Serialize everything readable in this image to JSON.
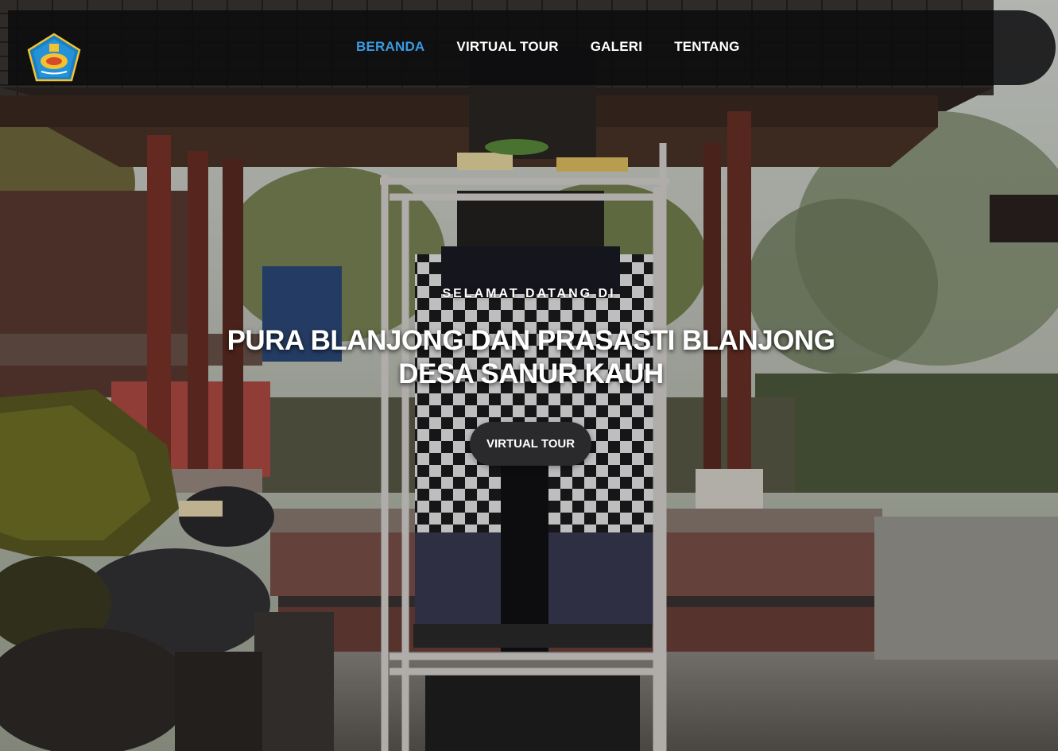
{
  "colors": {
    "accent": "#3a9ae0",
    "navbar_bg": "#0c0c0e",
    "cta_bg": "#2a2a2d",
    "text": "#ffffff"
  },
  "navbar": {
    "logo_icon": "regional-emblem-icon",
    "items": [
      {
        "label": "BERANDA",
        "active": true
      },
      {
        "label": "VIRTUAL TOUR",
        "active": false
      },
      {
        "label": "GALERI",
        "active": false
      },
      {
        "label": "TENTANG",
        "active": false
      }
    ]
  },
  "hero": {
    "welcome": "SELAMAT DATANG DI",
    "title_line1": "PURA BLANJONG DAN PRASASTI BLANJONG",
    "title_line2": "DESA SANUR KAUH",
    "cta_label": "VIRTUAL TOUR"
  }
}
